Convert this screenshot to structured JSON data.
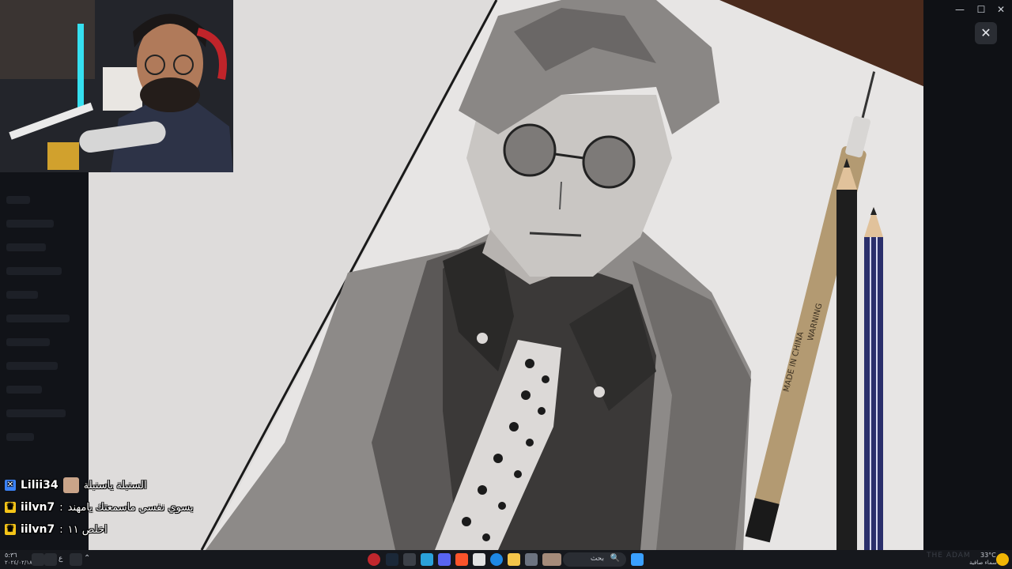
{
  "window": {
    "minimize_glyph": "—",
    "maximize_glyph": "☐",
    "close_glyph": "✕",
    "overlay_close_glyph": "✕"
  },
  "chat": {
    "messages": [
      {
        "platform_badge": "kick-icon",
        "badge_color": "#3b82f6",
        "username": "Lilii34",
        "separator": ":",
        "message": "السنبلة ياسنبلة",
        "has_avatar": true
      },
      {
        "platform_badge": "crown-icon",
        "badge_color": "#f5c518",
        "username": "iilvn7",
        "separator": ":",
        "message": "بسوي نفسي ماسمعتك يامهند",
        "has_avatar": false
      },
      {
        "platform_badge": "crown-icon",
        "badge_color": "#f5c518",
        "username": "iilvn7",
        "separator": ":",
        "message": "اخلص ١١",
        "has_avatar": false
      }
    ]
  },
  "drawing": {
    "pen_label_1": "MADE IN CHINA",
    "pen_label_2": "WARNING"
  },
  "taskbar": {
    "search_label": "بحث",
    "search_icon": "🔍",
    "clock_time": "٥:٣٦",
    "clock_date": "٢٠٢٤/٠٢/١٨",
    "weather_temp": "33°C",
    "weather_desc": "سماء صافية",
    "lang": "ع",
    "watermark": "THE ADAM"
  }
}
